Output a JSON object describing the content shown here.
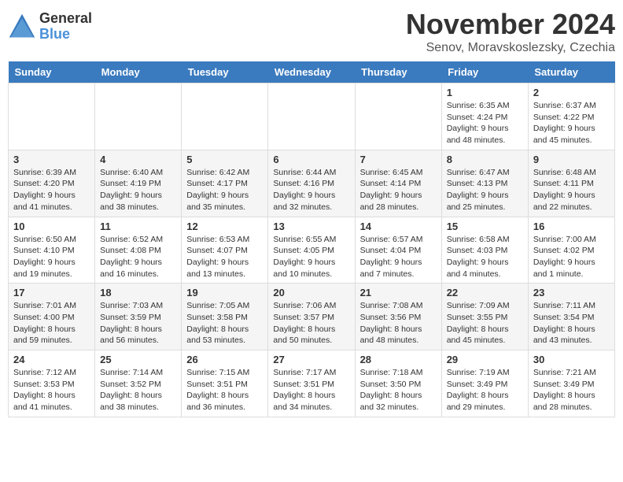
{
  "logo": {
    "general": "General",
    "blue": "Blue"
  },
  "header": {
    "month": "November 2024",
    "location": "Senov, Moravskoslezsky, Czechia"
  },
  "days_of_week": [
    "Sunday",
    "Monday",
    "Tuesday",
    "Wednesday",
    "Thursday",
    "Friday",
    "Saturday"
  ],
  "weeks": [
    [
      {
        "day": "",
        "info": ""
      },
      {
        "day": "",
        "info": ""
      },
      {
        "day": "",
        "info": ""
      },
      {
        "day": "",
        "info": ""
      },
      {
        "day": "",
        "info": ""
      },
      {
        "day": "1",
        "info": "Sunrise: 6:35 AM\nSunset: 4:24 PM\nDaylight: 9 hours\nand 48 minutes."
      },
      {
        "day": "2",
        "info": "Sunrise: 6:37 AM\nSunset: 4:22 PM\nDaylight: 9 hours\nand 45 minutes."
      }
    ],
    [
      {
        "day": "3",
        "info": "Sunrise: 6:39 AM\nSunset: 4:20 PM\nDaylight: 9 hours\nand 41 minutes."
      },
      {
        "day": "4",
        "info": "Sunrise: 6:40 AM\nSunset: 4:19 PM\nDaylight: 9 hours\nand 38 minutes."
      },
      {
        "day": "5",
        "info": "Sunrise: 6:42 AM\nSunset: 4:17 PM\nDaylight: 9 hours\nand 35 minutes."
      },
      {
        "day": "6",
        "info": "Sunrise: 6:44 AM\nSunset: 4:16 PM\nDaylight: 9 hours\nand 32 minutes."
      },
      {
        "day": "7",
        "info": "Sunrise: 6:45 AM\nSunset: 4:14 PM\nDaylight: 9 hours\nand 28 minutes."
      },
      {
        "day": "8",
        "info": "Sunrise: 6:47 AM\nSunset: 4:13 PM\nDaylight: 9 hours\nand 25 minutes."
      },
      {
        "day": "9",
        "info": "Sunrise: 6:48 AM\nSunset: 4:11 PM\nDaylight: 9 hours\nand 22 minutes."
      }
    ],
    [
      {
        "day": "10",
        "info": "Sunrise: 6:50 AM\nSunset: 4:10 PM\nDaylight: 9 hours\nand 19 minutes."
      },
      {
        "day": "11",
        "info": "Sunrise: 6:52 AM\nSunset: 4:08 PM\nDaylight: 9 hours\nand 16 minutes."
      },
      {
        "day": "12",
        "info": "Sunrise: 6:53 AM\nSunset: 4:07 PM\nDaylight: 9 hours\nand 13 minutes."
      },
      {
        "day": "13",
        "info": "Sunrise: 6:55 AM\nSunset: 4:05 PM\nDaylight: 9 hours\nand 10 minutes."
      },
      {
        "day": "14",
        "info": "Sunrise: 6:57 AM\nSunset: 4:04 PM\nDaylight: 9 hours\nand 7 minutes."
      },
      {
        "day": "15",
        "info": "Sunrise: 6:58 AM\nSunset: 4:03 PM\nDaylight: 9 hours\nand 4 minutes."
      },
      {
        "day": "16",
        "info": "Sunrise: 7:00 AM\nSunset: 4:02 PM\nDaylight: 9 hours\nand 1 minute."
      }
    ],
    [
      {
        "day": "17",
        "info": "Sunrise: 7:01 AM\nSunset: 4:00 PM\nDaylight: 8 hours\nand 59 minutes."
      },
      {
        "day": "18",
        "info": "Sunrise: 7:03 AM\nSunset: 3:59 PM\nDaylight: 8 hours\nand 56 minutes."
      },
      {
        "day": "19",
        "info": "Sunrise: 7:05 AM\nSunset: 3:58 PM\nDaylight: 8 hours\nand 53 minutes."
      },
      {
        "day": "20",
        "info": "Sunrise: 7:06 AM\nSunset: 3:57 PM\nDaylight: 8 hours\nand 50 minutes."
      },
      {
        "day": "21",
        "info": "Sunrise: 7:08 AM\nSunset: 3:56 PM\nDaylight: 8 hours\nand 48 minutes."
      },
      {
        "day": "22",
        "info": "Sunrise: 7:09 AM\nSunset: 3:55 PM\nDaylight: 8 hours\nand 45 minutes."
      },
      {
        "day": "23",
        "info": "Sunrise: 7:11 AM\nSunset: 3:54 PM\nDaylight: 8 hours\nand 43 minutes."
      }
    ],
    [
      {
        "day": "24",
        "info": "Sunrise: 7:12 AM\nSunset: 3:53 PM\nDaylight: 8 hours\nand 41 minutes."
      },
      {
        "day": "25",
        "info": "Sunrise: 7:14 AM\nSunset: 3:52 PM\nDaylight: 8 hours\nand 38 minutes."
      },
      {
        "day": "26",
        "info": "Sunrise: 7:15 AM\nSunset: 3:51 PM\nDaylight: 8 hours\nand 36 minutes."
      },
      {
        "day": "27",
        "info": "Sunrise: 7:17 AM\nSunset: 3:51 PM\nDaylight: 8 hours\nand 34 minutes."
      },
      {
        "day": "28",
        "info": "Sunrise: 7:18 AM\nSunset: 3:50 PM\nDaylight: 8 hours\nand 32 minutes."
      },
      {
        "day": "29",
        "info": "Sunrise: 7:19 AM\nSunset: 3:49 PM\nDaylight: 8 hours\nand 29 minutes."
      },
      {
        "day": "30",
        "info": "Sunrise: 7:21 AM\nSunset: 3:49 PM\nDaylight: 8 hours\nand 28 minutes."
      }
    ]
  ]
}
